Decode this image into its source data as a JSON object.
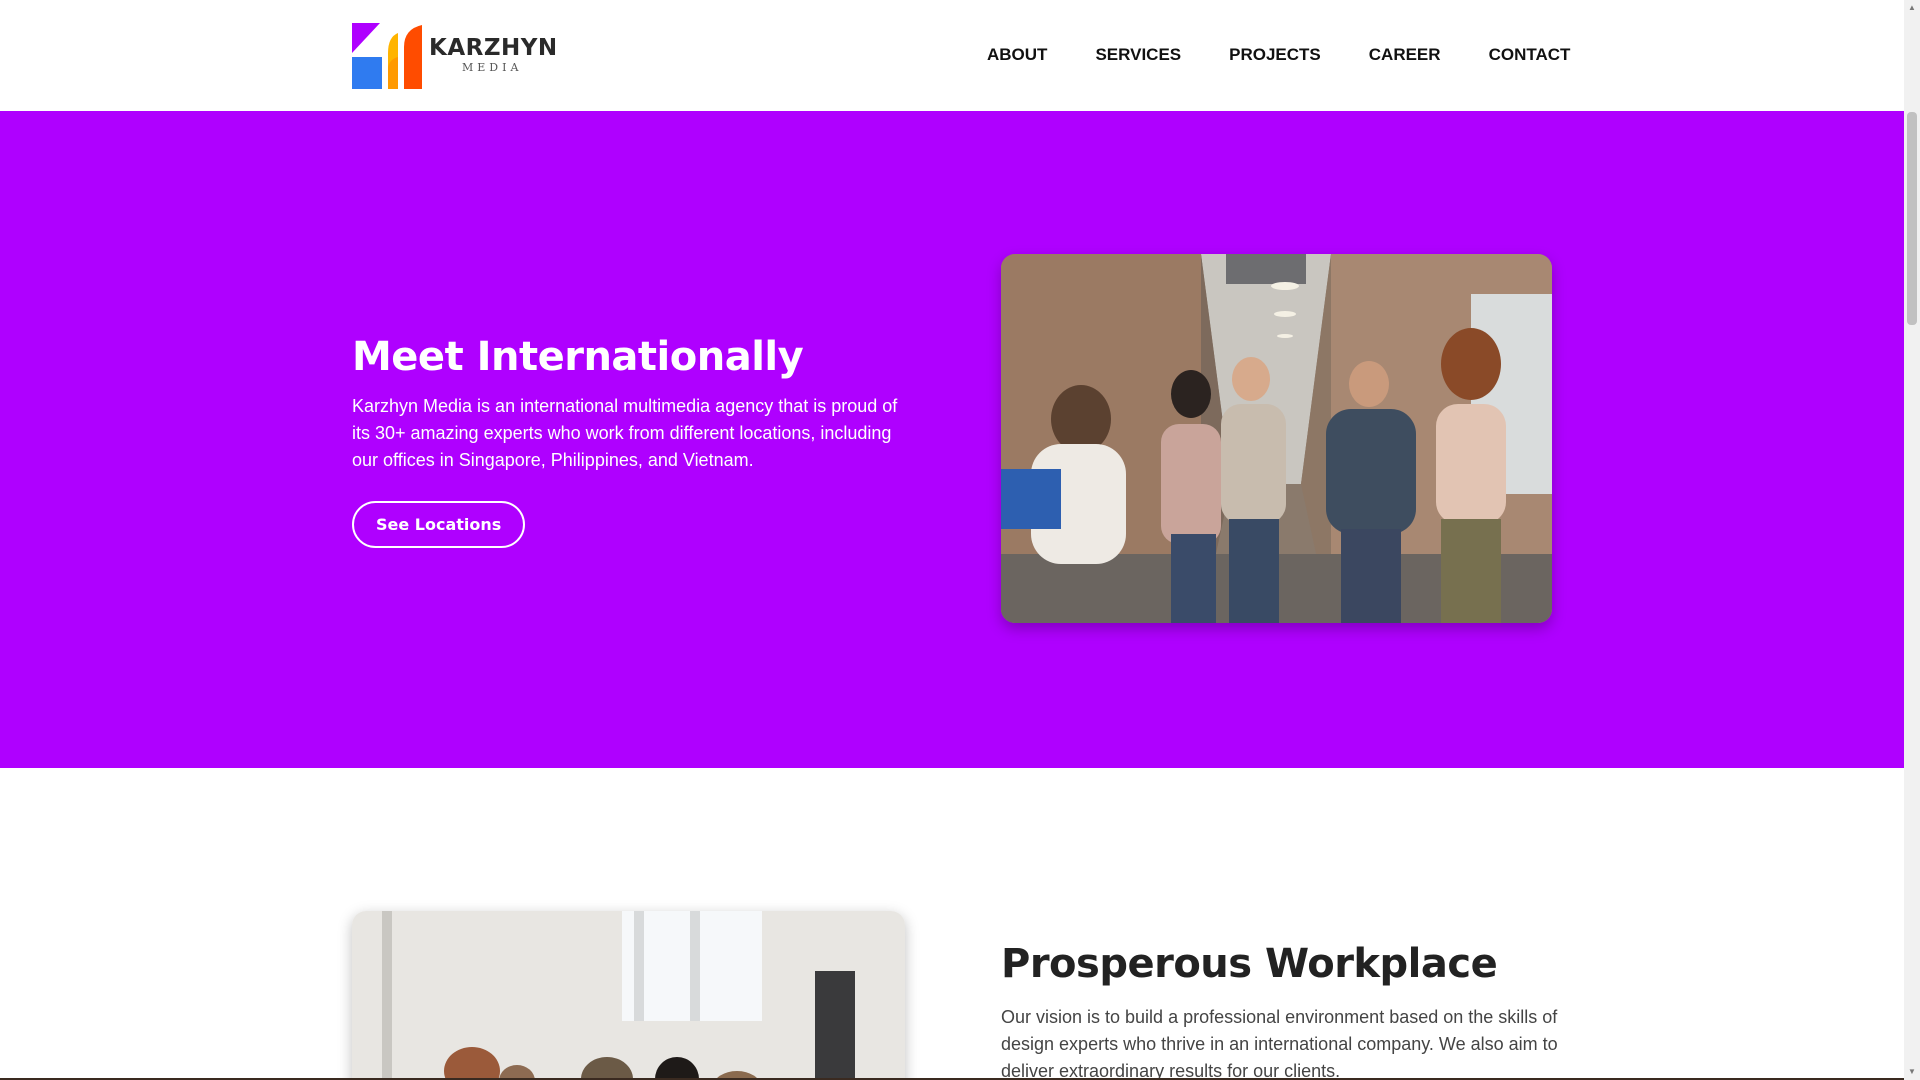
{
  "brand": {
    "name": "KARZHYN",
    "sub": "MEDIA",
    "colors": {
      "purple": "#af00ff",
      "blue": "#2f7bf0",
      "yellow": "#ffb400",
      "orange": "#ff4c00",
      "red": "#ff2020"
    }
  },
  "nav": {
    "items": [
      {
        "label": "ABOUT"
      },
      {
        "label": "SERVICES"
      },
      {
        "label": "PROJECTS"
      },
      {
        "label": "CAREER"
      },
      {
        "label": "CONTACT"
      }
    ]
  },
  "hero": {
    "title": "Meet Internationally",
    "text": "Karzhyn Media is an international multimedia agency that is proud of its 30+ amazing experts who work from different locations, including our offices in Singapore, Philippines, and Vietnam.",
    "button": "See Locations",
    "background": "#af00ff"
  },
  "workplace": {
    "title": "Prosperous Workplace",
    "text": "Our vision is to build a professional environment based on the skills of design experts who thrive in an international company. We also aim to deliver extraordinary results for our clients."
  }
}
